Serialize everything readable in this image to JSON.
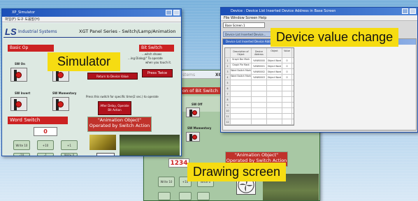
{
  "labels": {
    "simulator": "Simulator",
    "device": "Device value change",
    "drawing": "Drawing screen"
  },
  "sim": {
    "title": "XP_Simulator",
    "menu": "파일(F)   도구   도움말(H)",
    "brand": "Industrial Systems",
    "panel_title": "XGT Panel Series - Switch/Lamp/Animation",
    "basic": "Basic Op",
    "bit_switch": "Bit Switch",
    "word_switch": "Word Switch",
    "value": "0",
    "sw_on": "SW On",
    "sw_invert": "SW Invert",
    "sw_momentary": "SW Momentary",
    "anim": "\"Animation Object\"",
    "anim2": "Operated by Switch Action",
    "note": "Press this switch for specific time(2 sec.) to operate",
    "shown": "...witch shows",
    "dialog": "...ing Dialog)\"  To operate",
    "when": "when you touch it.",
    "return_btn": "Return to Device Value",
    "press_twice": "Press Twice",
    "after_delay": "After Delay, Operate Bit Action",
    "btns": [
      "Write 10",
      "+10",
      "+1",
      "-1",
      "-10",
      "Write 0"
    ]
  },
  "dev": {
    "title": "Device : Device List Inserted Device Address in Base Screen",
    "menu": "File   Window   Screen   Help",
    "combo": "Base Screen 1",
    "tab": "Device List Inserted Device...",
    "inner_title": "Device List Inserted Device Address in Base Screen",
    "cols": [
      "",
      "Description of Object",
      "Device Address",
      "Object",
      "Value"
    ],
    "rows": [
      [
        "1",
        "Graph Bar Mark",
        "%MW0000",
        "Object Word",
        "0"
      ],
      [
        "2",
        "Graph Pie Mark",
        "%MW0001",
        "Object Word",
        "0"
      ],
      [
        "3",
        "Word Switch Mark",
        "%MW0002",
        "Object Word",
        "0"
      ],
      [
        "4",
        "Word Switch Mark",
        "%MW0003",
        "Object Word",
        "0"
      ],
      [
        "5",
        "",
        "",
        "",
        ""
      ],
      [
        "6",
        "",
        "",
        "",
        ""
      ],
      [
        "7",
        "",
        "",
        "",
        ""
      ],
      [
        "8",
        "",
        "",
        "",
        ""
      ],
      [
        "9",
        "",
        "",
        "",
        ""
      ],
      [
        "10",
        "",
        "",
        "",
        ""
      ],
      [
        "11",
        "",
        "",
        "",
        ""
      ],
      [
        "12",
        "",
        "",
        "",
        ""
      ]
    ]
  },
  "draw": {
    "title_frag": "stems",
    "xg": "XG",
    "bit_title": "on of Bit Switch",
    "sw_off": "SW Off",
    "sw_momentary": "SW Momentary",
    "after_delay": "After Delay, Operate Bit Action",
    "anim": "\"Animation Object\"",
    "anim2": "Operated by Switch Action",
    "value": "1234",
    "btns": [
      "Write 10",
      "+10",
      "Write 0"
    ]
  },
  "colors": {
    "label": "#f6dc12",
    "title": "#1b4fb8",
    "header_red": "#cc2222",
    "panel_green": "#cfe7c8"
  }
}
